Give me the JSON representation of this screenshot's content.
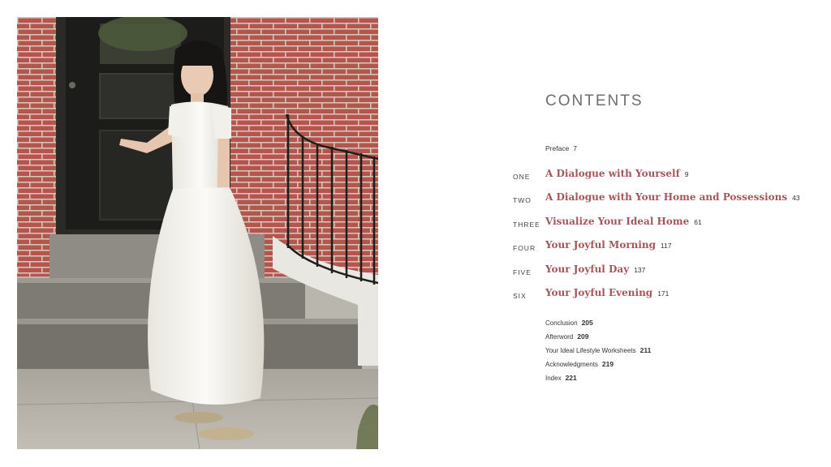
{
  "photo": {
    "alt_subject": "woman in white dress on brick porch steps"
  },
  "contents": {
    "title": "CONTENTS",
    "preface": {
      "label": "Preface",
      "page": "7"
    },
    "chapters": [
      {
        "number": "ONE",
        "title": "A Dialogue with Yourself",
        "page": "9"
      },
      {
        "number": "TWO",
        "title": "A Dialogue with Your Home and Possessions",
        "page": "43"
      },
      {
        "number": "THREE",
        "title": "Visualize Your Ideal Home",
        "page": "61"
      },
      {
        "number": "FOUR",
        "title": "Your Joyful Morning",
        "page": "117"
      },
      {
        "number": "FIVE",
        "title": "Your Joyful Day",
        "page": "137"
      },
      {
        "number": "SIX",
        "title": "Your Joyful Evening",
        "page": "171"
      }
    ],
    "backmatter": [
      {
        "label": "Conclusion",
        "page": "205"
      },
      {
        "label": "Afterword",
        "page": "209"
      },
      {
        "label": "Your Ideal Lifestyle Worksheets",
        "page": "211"
      },
      {
        "label": "Acknowledgments",
        "page": "219"
      },
      {
        "label": "Index",
        "page": "221"
      }
    ]
  },
  "colors": {
    "chapter_title": "#a4565a",
    "heading": "#6e6e6e",
    "brick": "#b5564e"
  }
}
